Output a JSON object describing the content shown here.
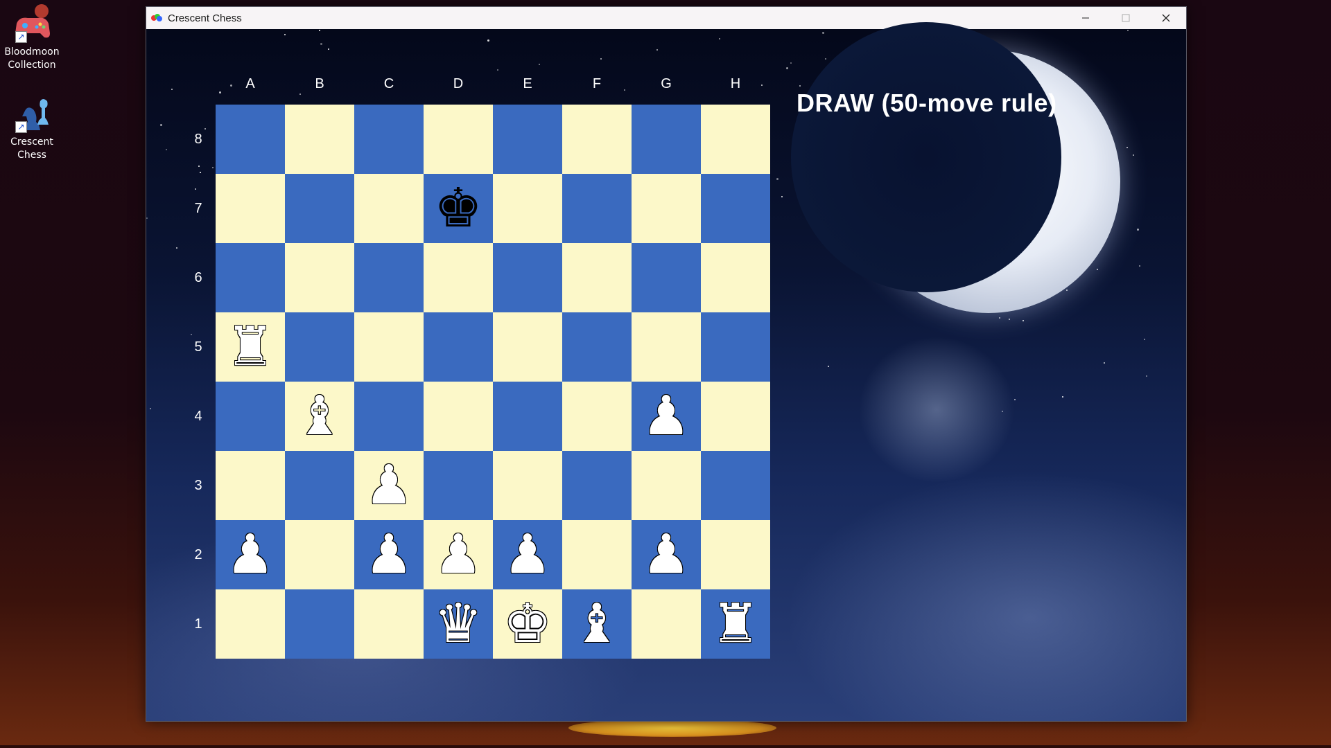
{
  "desktop": {
    "icons": [
      {
        "label_line1": "Bloodmoon",
        "label_line2": "Collection",
        "icon": "gamepad-icon"
      },
      {
        "label_line1": "Crescent",
        "label_line2": "Chess",
        "icon": "chess-pieces-icon"
      }
    ]
  },
  "window": {
    "title": "Crescent Chess",
    "controls": {
      "minimize": "minimize-icon",
      "maximize": "maximize-icon",
      "close": "close-icon"
    }
  },
  "game": {
    "status": "DRAW (50-move rule)",
    "files": [
      "A",
      "B",
      "C",
      "D",
      "E",
      "F",
      "G",
      "H"
    ],
    "ranks": [
      "8",
      "7",
      "6",
      "5",
      "4",
      "3",
      "2",
      "1"
    ],
    "pieces": [
      {
        "square": "d7",
        "color": "black",
        "type": "king",
        "glyph": "♚"
      },
      {
        "square": "a5",
        "color": "white",
        "type": "rook",
        "glyph": "♜"
      },
      {
        "square": "b4",
        "color": "white",
        "type": "bishop",
        "glyph": "♝"
      },
      {
        "square": "g4",
        "color": "white",
        "type": "pawn",
        "glyph": "♟"
      },
      {
        "square": "c3",
        "color": "white",
        "type": "pawn",
        "glyph": "♟"
      },
      {
        "square": "a2",
        "color": "white",
        "type": "pawn",
        "glyph": "♟"
      },
      {
        "square": "c2",
        "color": "white",
        "type": "pawn",
        "glyph": "♟"
      },
      {
        "square": "d2",
        "color": "white",
        "type": "pawn",
        "glyph": "♟"
      },
      {
        "square": "e2",
        "color": "white",
        "type": "pawn",
        "glyph": "♟"
      },
      {
        "square": "g2",
        "color": "white",
        "type": "pawn",
        "glyph": "♟"
      },
      {
        "square": "d1",
        "color": "white",
        "type": "queen",
        "glyph": "♛"
      },
      {
        "square": "e1",
        "color": "white",
        "type": "king",
        "glyph": "♚"
      },
      {
        "square": "f1",
        "color": "white",
        "type": "bishop",
        "glyph": "♝"
      },
      {
        "square": "h1",
        "color": "white",
        "type": "rook",
        "glyph": "♜"
      }
    ],
    "colors": {
      "light_square": "#fcf8c9",
      "dark_square": "#3a6abf"
    }
  }
}
